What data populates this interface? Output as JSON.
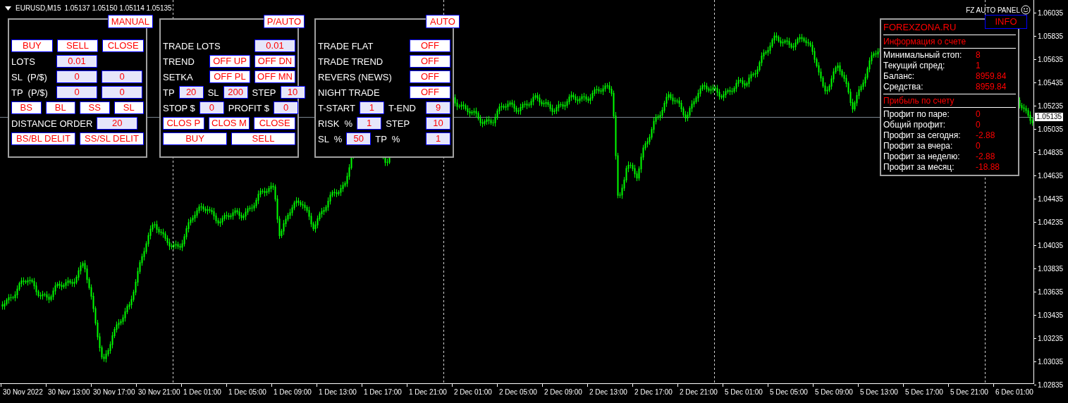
{
  "header": {
    "symbol": "EURUSD,M15",
    "quotes": "1.05137 1.05150 1.05114 1.05135",
    "panel_name": "FZ AUTO PANEL"
  },
  "panels": [
    {
      "title": "MANUAL",
      "rows": [
        {
          "items": [
            {
              "kind": "button",
              "text": "BUY"
            },
            {
              "kind": "button",
              "text": "SELL"
            },
            {
              "kind": "button",
              "text": "CLOSE"
            }
          ]
        },
        {
          "items": [
            {
              "kind": "label",
              "text": "LOTS"
            },
            {
              "kind": "field",
              "text": "0.01"
            }
          ]
        },
        {
          "items": [
            {
              "kind": "label",
              "text": "SL  (P/$)"
            },
            {
              "kind": "field",
              "text": "0"
            },
            {
              "kind": "field",
              "text": "0"
            }
          ]
        },
        {
          "items": [
            {
              "kind": "label",
              "text": "TP  (P/$)"
            },
            {
              "kind": "field",
              "text": "0"
            },
            {
              "kind": "field",
              "text": "0"
            }
          ]
        },
        {
          "items": [
            {
              "kind": "button",
              "text": "BS"
            },
            {
              "kind": "button",
              "text": "BL"
            },
            {
              "kind": "button",
              "text": "SS"
            },
            {
              "kind": "button",
              "text": "SL"
            }
          ]
        },
        {
          "items": [
            {
              "kind": "label",
              "text": "DISTANCE ORDER"
            },
            {
              "kind": "field",
              "text": "20"
            }
          ]
        },
        {
          "items": [
            {
              "kind": "button",
              "text": "BS/BL DELIT"
            },
            {
              "kind": "button",
              "text": "SS/SL DELIT"
            }
          ]
        }
      ]
    },
    {
      "title": "P/AUTO",
      "rows": [
        {
          "items": [
            {
              "kind": "label",
              "text": "TRADE LOTS"
            },
            {
              "kind": "field",
              "text": "0.01"
            }
          ]
        },
        {
          "items": [
            {
              "kind": "label",
              "text": "TREND"
            },
            {
              "kind": "button",
              "text": "OFF UP"
            },
            {
              "kind": "button",
              "text": "OFF DN"
            }
          ]
        },
        {
          "items": [
            {
              "kind": "label",
              "text": "SETKA"
            },
            {
              "kind": "button",
              "text": "OFF PL"
            },
            {
              "kind": "button",
              "text": "OFF MN"
            }
          ]
        },
        {
          "items": [
            {
              "kind": "label",
              "text": "TP"
            },
            {
              "kind": "field",
              "text": "20"
            },
            {
              "kind": "label",
              "text": "SL"
            },
            {
              "kind": "field",
              "text": "200"
            },
            {
              "kind": "label",
              "text": "STEP"
            },
            {
              "kind": "field",
              "text": "10"
            }
          ]
        },
        {
          "items": [
            {
              "kind": "label",
              "text": "STOP $"
            },
            {
              "kind": "field",
              "text": "0"
            },
            {
              "kind": "label",
              "text": "PROFIT $"
            },
            {
              "kind": "field",
              "text": "0"
            }
          ]
        },
        {
          "items": [
            {
              "kind": "button",
              "text": "CLOS P"
            },
            {
              "kind": "button",
              "text": "CLOS M"
            },
            {
              "kind": "button",
              "text": "CLOSE"
            }
          ]
        },
        {
          "items": [
            {
              "kind": "button",
              "text": "BUY"
            },
            {
              "kind": "button",
              "text": "SELL"
            }
          ]
        }
      ]
    },
    {
      "title": "AUTO",
      "rows": [
        {
          "items": [
            {
              "kind": "label",
              "text": "TRADE FLAT"
            },
            {
              "kind": "button",
              "text": "OFF"
            }
          ]
        },
        {
          "items": [
            {
              "kind": "label",
              "text": "TRADE TREND"
            },
            {
              "kind": "button",
              "text": "OFF"
            }
          ]
        },
        {
          "items": [
            {
              "kind": "label",
              "text": "REVERS (NEWS)"
            },
            {
              "kind": "button",
              "text": "OFF"
            }
          ]
        },
        {
          "items": [
            {
              "kind": "label",
              "text": "NIGHT TRADE"
            },
            {
              "kind": "button",
              "text": "OFF"
            }
          ]
        },
        {
          "items": [
            {
              "kind": "label",
              "text": "T-START"
            },
            {
              "kind": "field",
              "text": "1"
            },
            {
              "kind": "label",
              "text": "T-END"
            },
            {
              "kind": "field",
              "text": "9"
            }
          ]
        },
        {
          "items": [
            {
              "kind": "label",
              "text": "RISK  %"
            },
            {
              "kind": "field",
              "text": "1"
            },
            {
              "kind": "label",
              "text": "STEP"
            },
            {
              "kind": "field",
              "text": "10"
            }
          ]
        },
        {
          "items": [
            {
              "kind": "label",
              "text": "SL  %"
            },
            {
              "kind": "field",
              "text": "50"
            },
            {
              "kind": "label",
              "text": "TP  %"
            },
            {
              "kind": "field",
              "text": "1"
            }
          ]
        }
      ]
    }
  ],
  "info": {
    "tab": "INFO",
    "site": "FOREXZONA.RU",
    "sections": [
      {
        "heading": "Информация о счете",
        "rows": [
          {
            "label": "Минимальный стоп:",
            "value": "8"
          },
          {
            "label": "Текущий спред:",
            "value": "1"
          },
          {
            "label": "Баланс:",
            "value": "8959.84"
          },
          {
            "label": "Средства:",
            "value": "8959.84"
          }
        ]
      },
      {
        "heading": "Прибыль по счету",
        "rows": [
          {
            "label": "Профит по паре:",
            "value": "0"
          },
          {
            "label": "Общий профит:",
            "value": "0"
          },
          {
            "label": "Профит за сегодня:",
            "value": "-2.88"
          },
          {
            "label": "Профит за вчера:",
            "value": "0"
          },
          {
            "label": "Профит за неделю:",
            "value": "-2.88"
          },
          {
            "label": "Профит за месяц:",
            "value": "-18.88"
          }
        ]
      }
    ]
  },
  "price_axis": {
    "labels": [
      "1.06035",
      "1.05835",
      "1.05635",
      "1.05435",
      "1.05235",
      "1.05035",
      "1.04835",
      "1.04635",
      "1.04435",
      "1.04235",
      "1.04035",
      "1.03835",
      "1.03635",
      "1.03435",
      "1.03235",
      "1.03035",
      "1.02835"
    ],
    "bid": "1.05135"
  },
  "time_axis": [
    "30 Nov 2022",
    "30 Nov 13:00",
    "30 Nov 17:00",
    "30 Nov 21:00",
    "1 Dec 01:00",
    "1 Dec 05:00",
    "1 Dec 09:00",
    "1 Dec 13:00",
    "1 Dec 17:00",
    "1 Dec 21:00",
    "2 Dec 01:00",
    "2 Dec 05:00",
    "2 Dec 09:00",
    "2 Dec 13:00",
    "2 Dec 17:00",
    "2 Dec 21:00",
    "5 Dec 01:00",
    "5 Dec 05:00",
    "5 Dec 09:00",
    "5 Dec 13:00",
    "5 Dec 17:00",
    "5 Dec 21:00",
    "6 Dec 01:00"
  ]
}
